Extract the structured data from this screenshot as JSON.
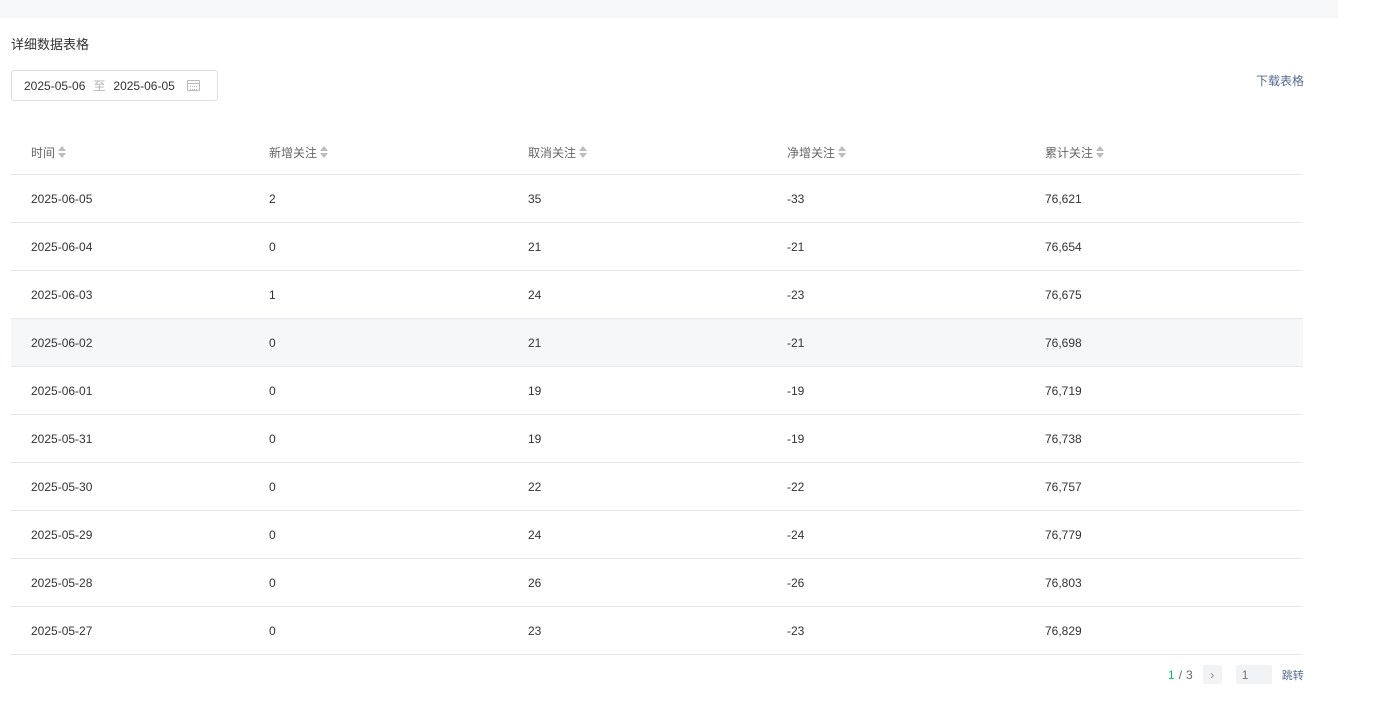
{
  "section": {
    "title": "详细数据表格"
  },
  "date_range": {
    "start": "2025-05-06",
    "separator": "至",
    "end": "2025-06-05"
  },
  "download": {
    "label": "下载表格"
  },
  "table": {
    "columns": [
      "时间",
      "新增关注",
      "取消关注",
      "净增关注",
      "累计关注"
    ],
    "rows": [
      [
        "2025-06-05",
        "2",
        "35",
        "-33",
        "76,621"
      ],
      [
        "2025-06-04",
        "0",
        "21",
        "-21",
        "76,654"
      ],
      [
        "2025-06-03",
        "1",
        "24",
        "-23",
        "76,675"
      ],
      [
        "2025-06-02",
        "0",
        "21",
        "-21",
        "76,698"
      ],
      [
        "2025-06-01",
        "0",
        "19",
        "-19",
        "76,719"
      ],
      [
        "2025-05-31",
        "0",
        "19",
        "-19",
        "76,738"
      ],
      [
        "2025-05-30",
        "0",
        "22",
        "-22",
        "76,757"
      ],
      [
        "2025-05-29",
        "0",
        "24",
        "-24",
        "76,779"
      ],
      [
        "2025-05-28",
        "0",
        "26",
        "-26",
        "76,803"
      ],
      [
        "2025-05-27",
        "0",
        "23",
        "-23",
        "76,829"
      ]
    ]
  },
  "pagination": {
    "current": "1",
    "separator": "/",
    "total": "3",
    "jump_placeholder": "1",
    "jump_label": "跳转"
  },
  "colors": {
    "accent_green": "#07c160",
    "link_blue": "#576b95"
  }
}
